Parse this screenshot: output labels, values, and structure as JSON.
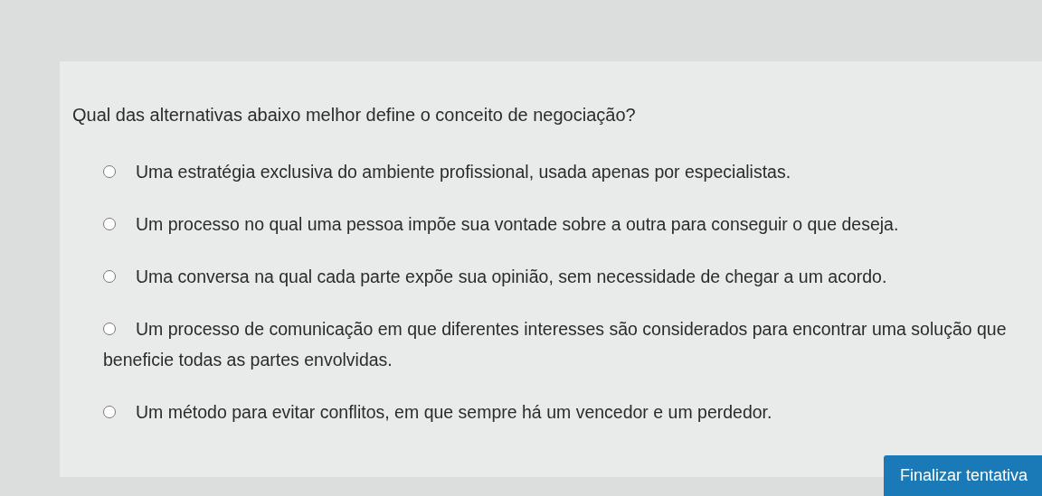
{
  "question": "Qual das alternativas abaixo melhor define o conceito de negociação?",
  "options": [
    {
      "label": "Uma estratégia exclusiva do ambiente profissional, usada apenas por especialistas.",
      "selected": false
    },
    {
      "label": "Um processo no qual uma pessoa impõe sua vontade sobre a outra para conseguir o que deseja.",
      "selected": false
    },
    {
      "label": "Uma conversa na qual cada parte expõe sua opinião, sem necessidade de chegar a um acordo.",
      "selected": false
    },
    {
      "label": "Um processo de comunicação em que diferentes interesses são considerados para encontrar uma solução que beneficie todas as partes envolvidas.",
      "selected": false
    },
    {
      "label": "Um método para evitar conflitos, em que sempre há um vencedor e um perdedor.",
      "selected": false
    }
  ],
  "submit_button": "Finalizar tentativa"
}
